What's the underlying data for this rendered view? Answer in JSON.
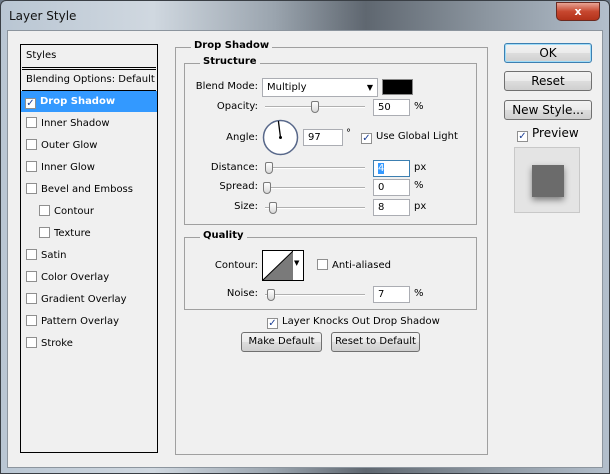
{
  "window": {
    "title": "Layer Style",
    "close": "x"
  },
  "styles_list": {
    "header": "Styles",
    "blending": "Blending Options: Default",
    "items": [
      {
        "label": "Drop Shadow",
        "checked": true,
        "selected": true
      },
      {
        "label": "Inner Shadow",
        "checked": false
      },
      {
        "label": "Outer Glow",
        "checked": false
      },
      {
        "label": "Inner Glow",
        "checked": false
      },
      {
        "label": "Bevel and Emboss",
        "checked": false
      },
      {
        "label": "Contour",
        "checked": false,
        "indent": true
      },
      {
        "label": "Texture",
        "checked": false,
        "indent": true
      },
      {
        "label": "Satin",
        "checked": false
      },
      {
        "label": "Color Overlay",
        "checked": false
      },
      {
        "label": "Gradient Overlay",
        "checked": false
      },
      {
        "label": "Pattern Overlay",
        "checked": false
      },
      {
        "label": "Stroke",
        "checked": false
      }
    ]
  },
  "drop_shadow": {
    "title": "Drop Shadow",
    "structure": {
      "title": "Structure",
      "blend_mode_label": "Blend Mode:",
      "blend_mode": "Multiply",
      "color": "#000000",
      "opacity_label": "Opacity:",
      "opacity": "50",
      "opacity_unit": "%",
      "angle_label": "Angle:",
      "angle": "97",
      "angle_unit": "°",
      "global_light": "Use Global Light",
      "global_light_checked": true,
      "distance_label": "Distance:",
      "distance": "4",
      "distance_unit": "px",
      "spread_label": "Spread:",
      "spread": "0",
      "spread_unit": "%",
      "size_label": "Size:",
      "size": "8",
      "size_unit": "px"
    },
    "quality": {
      "title": "Quality",
      "contour_label": "Contour:",
      "anti_aliased": "Anti-aliased",
      "anti_aliased_checked": false,
      "noise_label": "Noise:",
      "noise": "7",
      "noise_unit": "%"
    },
    "knockout": "Layer Knocks Out Drop Shadow",
    "knockout_checked": true,
    "make_default": "Make Default",
    "reset_default": "Reset to Default"
  },
  "buttons": {
    "ok": "OK",
    "reset": "Reset",
    "new_style": "New Style...",
    "preview": "Preview",
    "preview_checked": true
  },
  "check": "✓"
}
